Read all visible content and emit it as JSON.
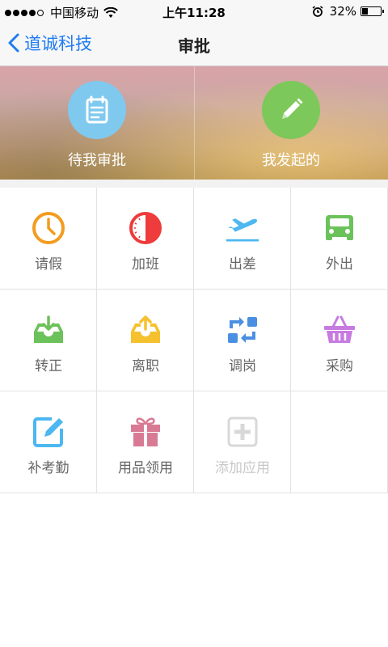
{
  "status_bar": {
    "carrier": "中国移动",
    "time": "上午11:28",
    "battery_percent": "32%",
    "battery_level": 0.32,
    "signal_bars": 4,
    "signal_total": 5
  },
  "nav": {
    "back_label": "道诚科技",
    "title": "审批"
  },
  "banner": {
    "items": [
      {
        "label": "待我审批",
        "icon": "document-list-icon",
        "color": "#7fc9ee"
      },
      {
        "label": "我发起的",
        "icon": "pencil-icon",
        "color": "#7cc85a"
      }
    ]
  },
  "apps": [
    {
      "label": "请假",
      "icon": "clock-icon",
      "color": "#f39c1e"
    },
    {
      "label": "加班",
      "icon": "half-clock-icon",
      "color": "#ee3b3b"
    },
    {
      "label": "出差",
      "icon": "airplane-icon",
      "color": "#4cb7f0"
    },
    {
      "label": "外出",
      "icon": "car-icon",
      "color": "#6cc25a"
    },
    {
      "label": "转正",
      "icon": "inbox-download-icon",
      "color": "#6cc25a"
    },
    {
      "label": "离职",
      "icon": "inbox-upload-icon",
      "color": "#f5c12e"
    },
    {
      "label": "调岗",
      "icon": "transfer-icon",
      "color": "#4a90e2"
    },
    {
      "label": "采购",
      "icon": "basket-icon",
      "color": "#c77be0"
    },
    {
      "label": "补考勤",
      "icon": "edit-square-icon",
      "color": "#4cb7f0"
    },
    {
      "label": "用品领用",
      "icon": "gift-icon",
      "color": "#d97a95"
    },
    {
      "label": "添加应用",
      "icon": "add-app-icon",
      "color": "#d8d8d8"
    }
  ],
  "colors": {
    "accent": "#1f7cf3"
  }
}
